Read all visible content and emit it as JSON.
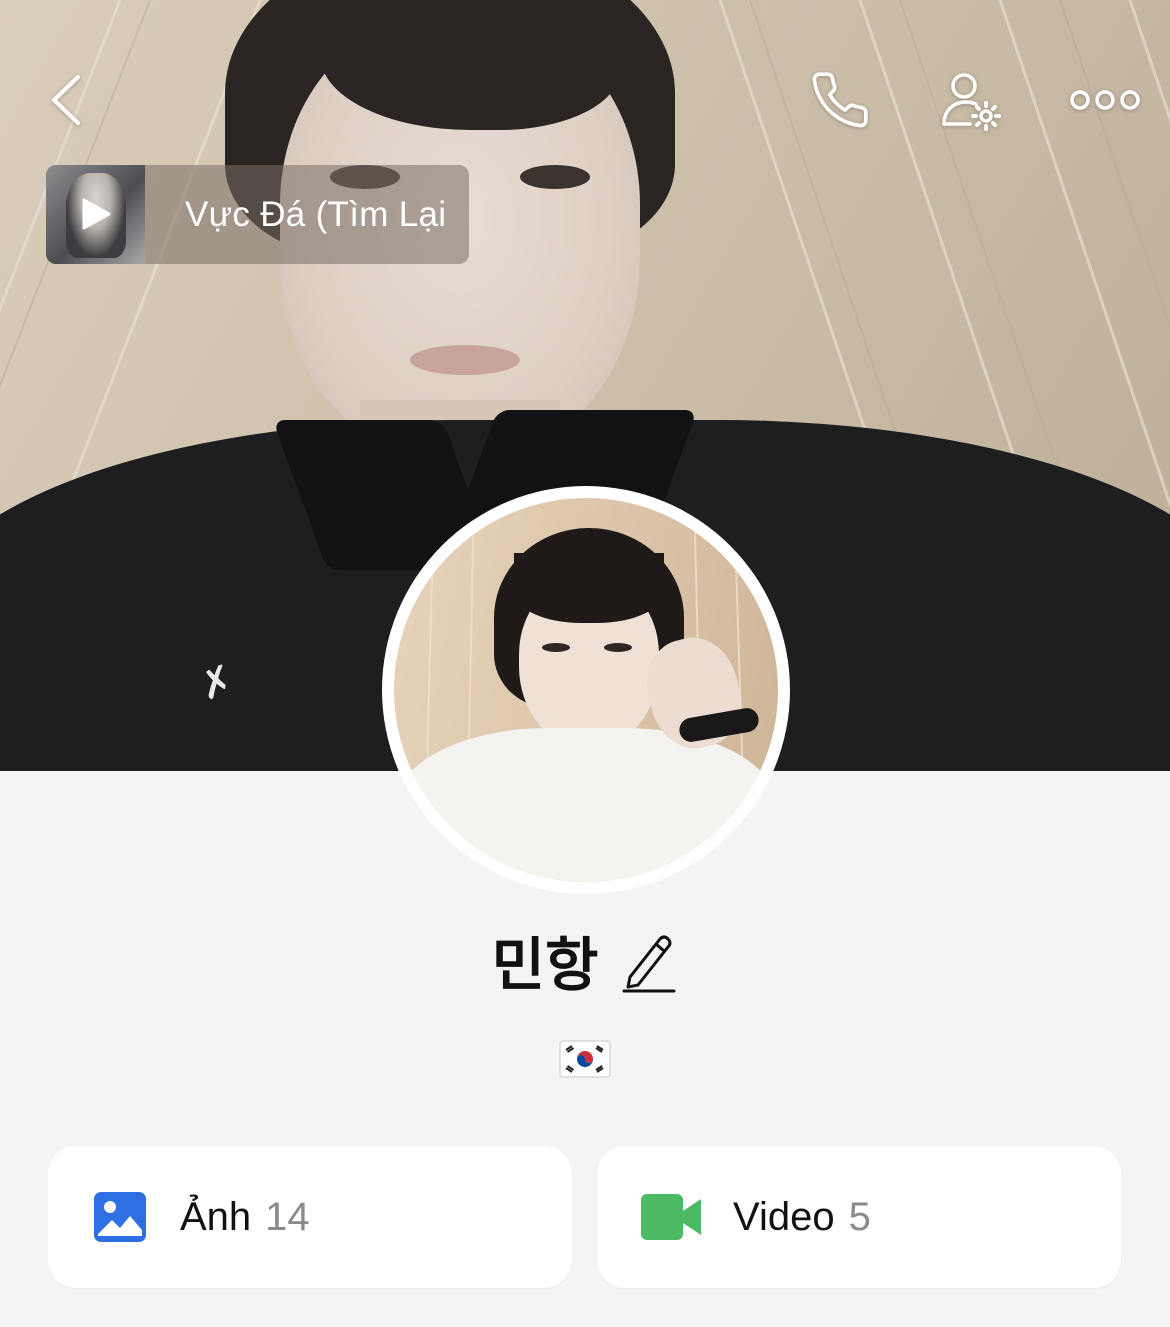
{
  "nav": {
    "back_icon": "chevron-left-icon",
    "call_icon": "phone-icon",
    "settings_icon": "user-settings-icon",
    "more_icon": "more-horizontal-icon"
  },
  "music": {
    "title": "Vực Đá (Tìm Lại",
    "play_icon": "play-icon"
  },
  "profile": {
    "name": "민항",
    "edit_icon": "pencil-icon",
    "bio_emoji": "south-korea-flag-emoji"
  },
  "media": {
    "photos": {
      "label": "Ảnh",
      "count": "14",
      "icon": "image-icon",
      "color": "#2f6fe4"
    },
    "videos": {
      "label": "Video",
      "count": "5",
      "icon": "video-camera-icon",
      "color": "#4cb964"
    }
  },
  "colors": {
    "background": "#f4f4f6",
    "card": "#ffffff",
    "count_text": "#8a8a8e"
  }
}
